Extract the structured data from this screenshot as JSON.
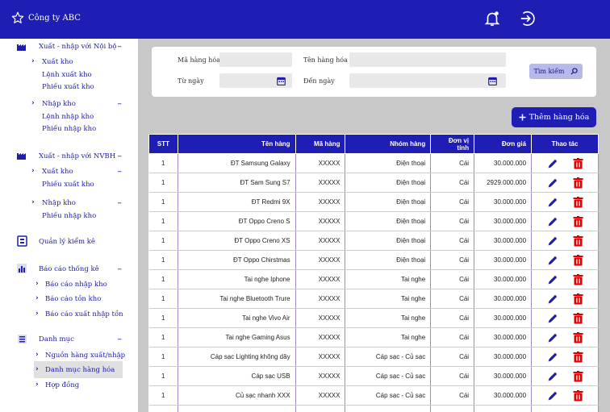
{
  "app": {
    "brand": "Công ty ABC"
  },
  "sidebar": {
    "group1": {
      "title": "Xuất - nhập với Nội bộ",
      "sub1": {
        "title": "Xuất kho",
        "items": [
          "Lệnh xuất kho",
          "Phiếu xuất kho"
        ]
      },
      "sub2": {
        "title": "Nhập kho",
        "items": [
          "Lệnh nhập kho",
          "Phiếu nhập kho"
        ]
      }
    },
    "group2": {
      "title": "Xuất - nhập với NVBH",
      "sub1": {
        "title": "Xuất kho",
        "items": [
          "Phiếu xuất kho"
        ]
      },
      "sub2": {
        "title": "Nhập kho",
        "items": [
          "Phiếu nhập kho"
        ]
      }
    },
    "inventory": "Quản lý kiểm kê",
    "reports": {
      "title": "Báo cáo thống kê",
      "items": [
        "Báo cáo nhập kho",
        "Báo cáo tồn kho",
        "Báo cáo xuất nhập tồn"
      ]
    },
    "catalog": {
      "title": "Danh mục",
      "items": [
        "Nguồn hàng xuất/nhập",
        "Danh mục hàng hóa",
        "Hợp đồng"
      ]
    },
    "collapse_symbol": "–"
  },
  "filter": {
    "code_label": "Mã hàng hóa",
    "name_label": "Tên hàng hóa",
    "from_label": "Từ ngày",
    "to_label": "Đến ngày",
    "search_label": "Tìm kiếm"
  },
  "add_button": "Thêm hàng hóa",
  "table": {
    "headers": [
      "STT",
      "Tên hàng",
      "Mã hàng",
      "Nhóm hàng",
      "Đơn vị tính",
      "Đơn giá",
      "Thao tác"
    ],
    "rows": [
      [
        "1",
        "ĐT Samsung Galaxy",
        "XXXXX",
        "Điện thoại",
        "Cái",
        "30.000.000"
      ],
      [
        "1",
        "ĐT Sam Sung S7",
        "XXXXX",
        "Điện thoại",
        "Cái",
        "2929.000.000"
      ],
      [
        "1",
        "ĐT Redmi 9X",
        "XXXXX",
        "Điện thoại",
        "Cái",
        "30.000.000"
      ],
      [
        "1",
        "ĐT Oppo Creno S",
        "XXXXX",
        "Điện thoại",
        "Cái",
        "30.000.000"
      ],
      [
        "1",
        "ĐT Oppo Creno XS",
        "XXXXX",
        "Điện thoại",
        "Cái",
        "30.000.000"
      ],
      [
        "1",
        "ĐT Oppo Chirstmas",
        "XXXXX",
        "Điện thoại",
        "Cái",
        "30.000.000"
      ],
      [
        "1",
        "Tai nghe Iphone",
        "XXXXX",
        "Tai nghe",
        "Cái",
        "30.000.000"
      ],
      [
        "1",
        "Tai nghe Bluetooth Trure",
        "XXXXX",
        "Tai nghe",
        "Cái",
        "30.000.000"
      ],
      [
        "1",
        "Tai nghe Vivo Air",
        "XXXXX",
        "Tai nghe",
        "Cái",
        "30.000.000"
      ],
      [
        "1",
        "Tai nghe Gaming Asus",
        "XXXXX",
        "Tai nghe",
        "Cái",
        "30.000.000"
      ],
      [
        "1",
        "Cáp sạc Lighting không dây",
        "XXXXX",
        "Cáp sạc - Củ sạc",
        "Cái",
        "30.000.000"
      ],
      [
        "1",
        "Cáp sạc USB",
        "XXXXX",
        "Cáp sạc - Củ sạc",
        "Cái",
        "30.000.000"
      ],
      [
        "1",
        "Củ sạc nhanh XXX",
        "XXXXX",
        "Cáp sạc - Củ sạc",
        "Cái",
        "30.000.000"
      ],
      [
        "",
        "",
        "",
        "",
        "",
        ""
      ]
    ]
  },
  "colors": {
    "primary": "#1e1eb4",
    "danger": "#e00000",
    "search_bg": "#b7b8ec"
  },
  "icons": {
    "brand": "star-icon",
    "notify": "bell-icon",
    "logout": "logout-icon",
    "edit": "pencil-icon",
    "delete": "trash-icon",
    "calendar": "calendar-icon",
    "search": "search-icon",
    "add": "plus-icon"
  }
}
